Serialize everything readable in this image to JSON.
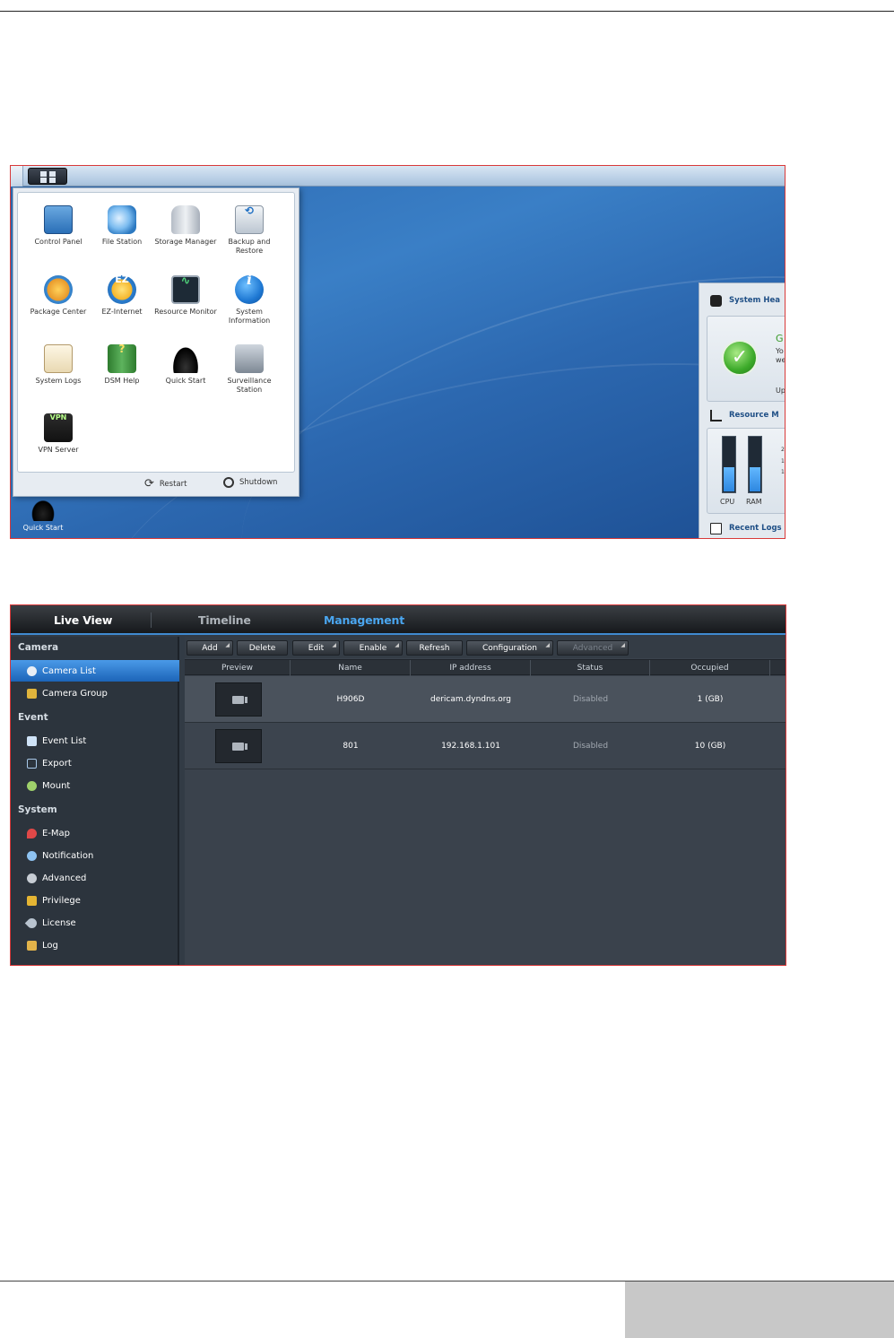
{
  "dsm": {
    "apps": [
      {
        "label": "Control Panel",
        "icon": "control-panel-icon"
      },
      {
        "label": "File Station",
        "icon": "file-station-icon"
      },
      {
        "label": "Storage Manager",
        "icon": "storage-manager-icon"
      },
      {
        "label": "Backup and Restore",
        "icon": "backup-restore-icon"
      },
      {
        "label": "Package Center",
        "icon": "package-center-icon"
      },
      {
        "label": "EZ-Internet",
        "icon": "ez-internet-icon"
      },
      {
        "label": "Resource Monitor",
        "icon": "resource-monitor-icon"
      },
      {
        "label": "System Information",
        "icon": "system-information-icon"
      },
      {
        "label": "System Logs",
        "icon": "system-logs-icon"
      },
      {
        "label": "DSM Help",
        "icon": "dsm-help-icon"
      },
      {
        "label": "Quick Start",
        "icon": "quick-start-icon"
      },
      {
        "label": "Surveillance Station",
        "icon": "surveillance-station-icon"
      },
      {
        "label": "VPN Server",
        "icon": "vpn-server-icon"
      }
    ],
    "restart_label": "Restart",
    "shutdown_label": "Shutdown",
    "desktop_shortcut": "Quick Start",
    "widget": {
      "health_title": "System Hea",
      "health_status_initial": "G",
      "health_line1": "Yo",
      "health_line2": "we",
      "health_update": "Up",
      "resource_title": "Resource M",
      "cpu_label": "CPU",
      "ram_label": "RAM",
      "tick_labels": [
        "2",
        "1",
        "1"
      ],
      "cpu_level": 0.45,
      "ram_level": 0.45,
      "logs_title": "Recent Logs"
    },
    "colors": {
      "desktop": "#2d6ab2",
      "accent": "#1f4f86"
    }
  },
  "surveillance": {
    "tabs": [
      {
        "label": "Live View",
        "active": false
      },
      {
        "label": "Timeline",
        "active": false
      },
      {
        "label": "Management",
        "active": true
      }
    ],
    "sidebar": {
      "sections": [
        {
          "title": "Camera",
          "items": [
            {
              "label": "Camera List",
              "icon": "camera-icon",
              "active": true
            },
            {
              "label": "Camera Group",
              "icon": "folder-icon",
              "active": false
            }
          ]
        },
        {
          "title": "Event",
          "items": [
            {
              "label": "Event List",
              "icon": "list-icon"
            },
            {
              "label": "Export",
              "icon": "export-icon"
            },
            {
              "label": "Mount",
              "icon": "mount-icon"
            }
          ]
        },
        {
          "title": "System",
          "items": [
            {
              "label": "E-Map",
              "icon": "map-pin-icon"
            },
            {
              "label": "Notification",
              "icon": "notification-icon"
            },
            {
              "label": "Advanced",
              "icon": "gear-icon"
            },
            {
              "label": "Privilege",
              "icon": "lock-icon"
            },
            {
              "label": "License",
              "icon": "key-icon"
            },
            {
              "label": "Log",
              "icon": "log-icon"
            }
          ]
        }
      ]
    },
    "toolbar": {
      "add": "Add",
      "delete": "Delete",
      "edit": "Edit",
      "enable": "Enable",
      "refresh": "Refresh",
      "configuration": "Configuration",
      "advanced": "Advanced"
    },
    "table": {
      "columns": [
        "Preview",
        "Name",
        "IP address",
        "Status",
        "Occupied"
      ],
      "rows": [
        {
          "name": "H906D",
          "ip": "dericam.dyndns.org",
          "status": "Disabled",
          "occupied": "1 (GB)"
        },
        {
          "name": "801",
          "ip": "192.168.1.101",
          "status": "Disabled",
          "occupied": "10 (GB)"
        }
      ]
    },
    "colors": {
      "accent": "#3f8ad0",
      "active_tab": "#4aa6f0",
      "sidebar_active": "#2f7fd2"
    }
  }
}
